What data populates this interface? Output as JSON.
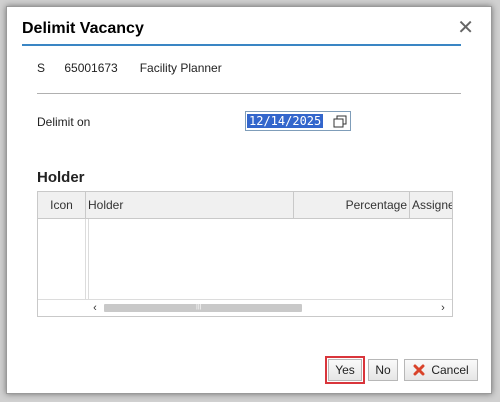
{
  "dialog": {
    "title": "Delimit Vacancy",
    "close_glyph": "✕"
  },
  "object": {
    "type": "S",
    "id": "65001673",
    "name": "Facility Planner"
  },
  "delimit": {
    "label": "Delimit on",
    "value": "12/14/2025"
  },
  "holder_section": {
    "title": "Holder",
    "columns": [
      "Icon",
      "Holder",
      "Percentage",
      "Assigne"
    ]
  },
  "scroll": {
    "left_arrow": "‹",
    "right_arrow": "›",
    "grip": "|||"
  },
  "buttons": {
    "yes": "Yes",
    "no": "No",
    "cancel": "Cancel"
  },
  "colors": {
    "title_rule": "#3a86c4",
    "highlight": "#d9353b",
    "cancel_icon": "#d9432a",
    "selection": "#3366cc"
  }
}
